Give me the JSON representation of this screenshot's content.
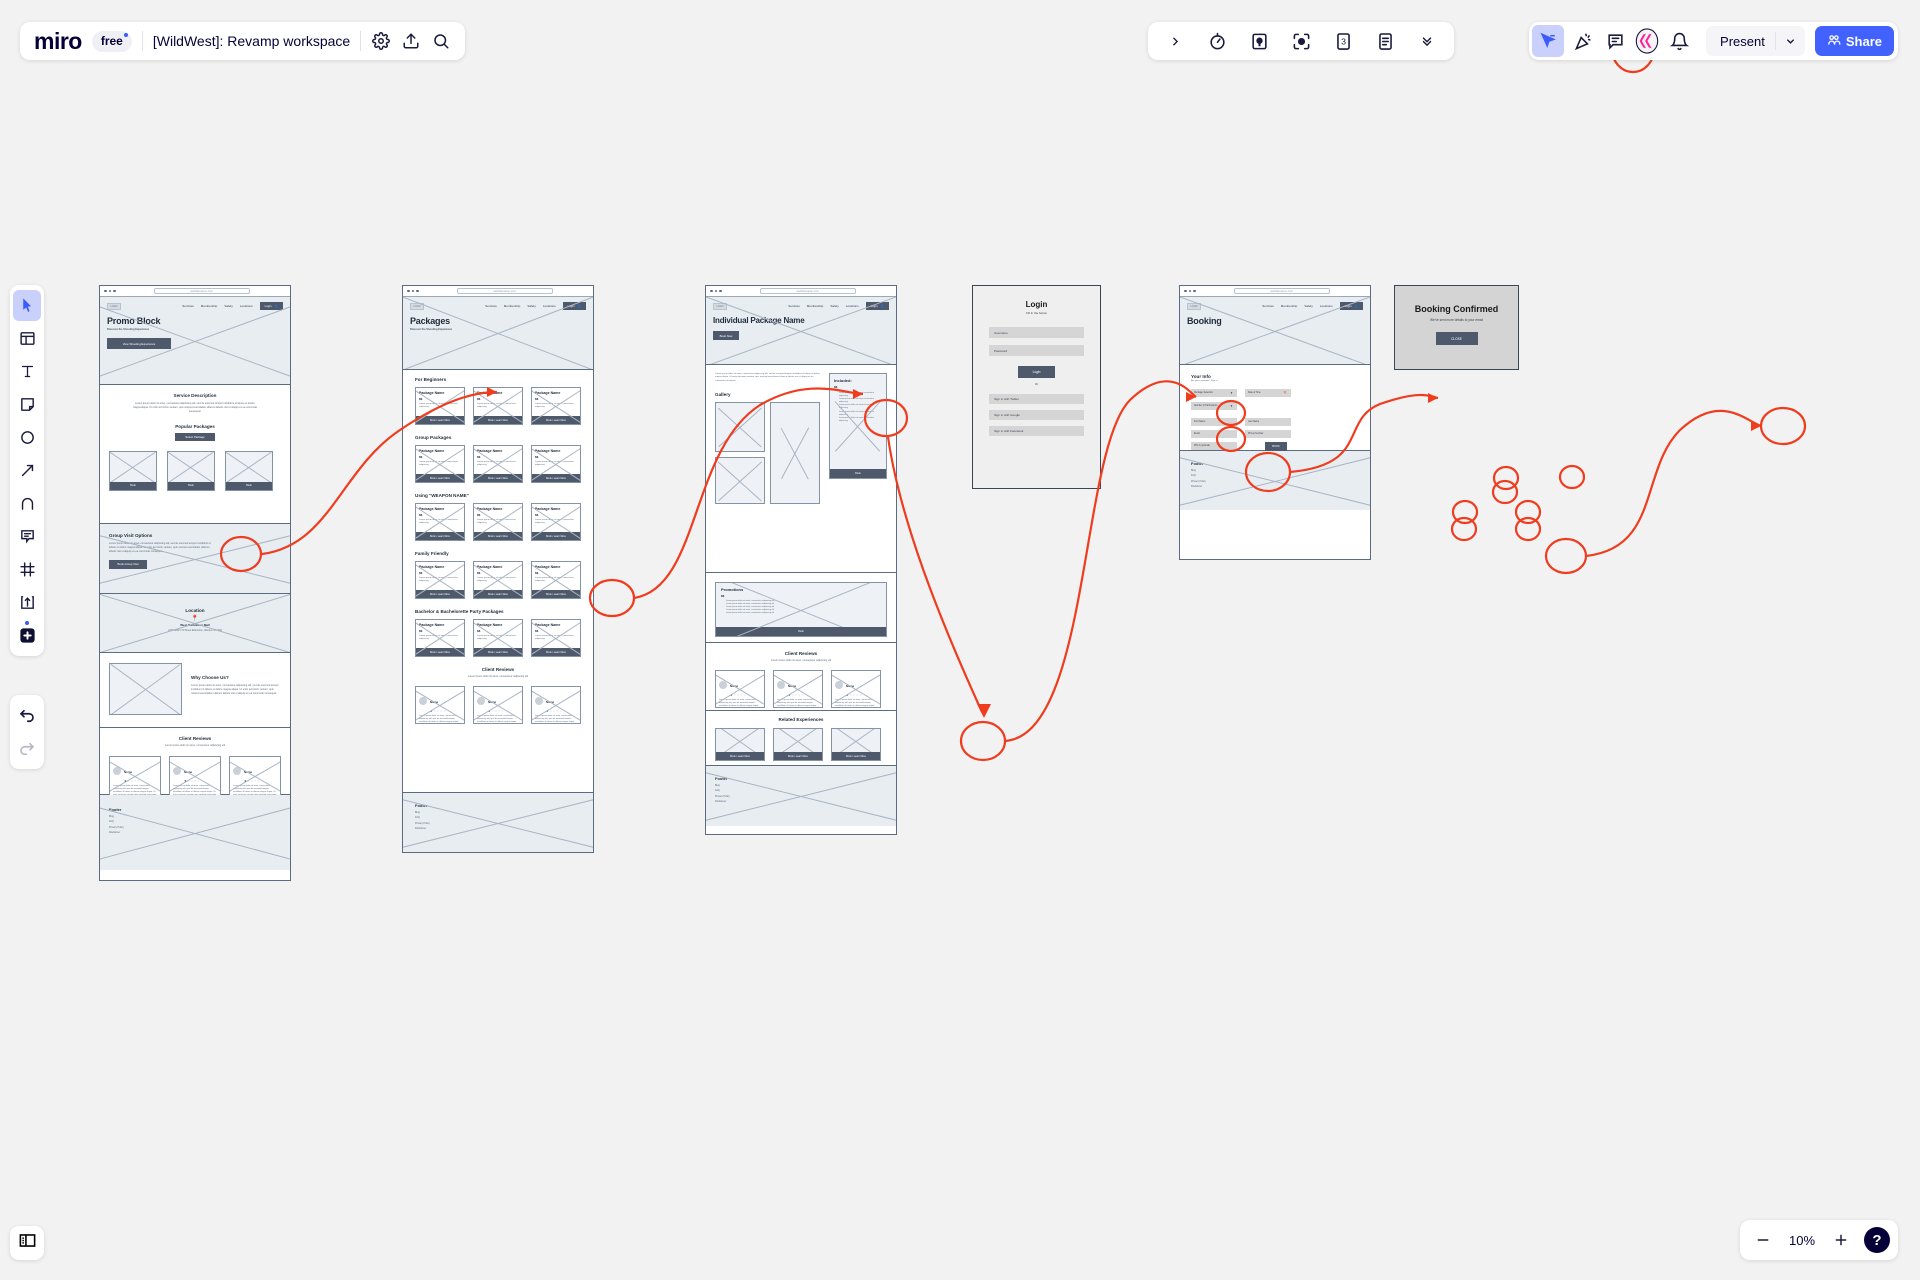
{
  "header": {
    "logo": "miro",
    "plan_badge": "free",
    "board_title": "[WildWest]: Revamp workspace",
    "icons": [
      "gear-icon",
      "upload-icon",
      "search-icon"
    ]
  },
  "toolbar_center": {
    "items": [
      "chevron-right-icon",
      "timer-icon",
      "video-icon",
      "focus-icon",
      "voting-icon",
      "notes-icon",
      "chevron-double-down-icon"
    ]
  },
  "toolbar_right": {
    "cursor_label": "cursor-share-icon",
    "reactions_label": "reactions-icon",
    "comment_label": "comment-icon",
    "miro_assist_label": "miro-ai-icon",
    "bell_label": "notifications-icon",
    "present_label": "Present",
    "share_label": "Share"
  },
  "left_toolbar": {
    "items": [
      {
        "name": "select-tool",
        "icon": "cursor-icon",
        "selected": true
      },
      {
        "name": "templates-tool",
        "icon": "templates-icon",
        "selected": false
      },
      {
        "name": "text-tool",
        "icon": "text-icon",
        "selected": false
      },
      {
        "name": "sticky-note-tool",
        "icon": "sticky-note-icon",
        "selected": false
      },
      {
        "name": "shapes-tool",
        "icon": "circle-icon",
        "selected": false
      },
      {
        "name": "connector-tool",
        "icon": "arrow-icon",
        "selected": false
      },
      {
        "name": "pen-tool",
        "icon": "pen-icon",
        "selected": false
      },
      {
        "name": "comment-tool",
        "icon": "comment-icon",
        "selected": false
      },
      {
        "name": "frame-tool",
        "icon": "frame-icon",
        "selected": false
      },
      {
        "name": "upload-tool",
        "icon": "upload-icon",
        "selected": false
      },
      {
        "name": "more-apps-tool",
        "icon": "plus-icon",
        "selected": false
      }
    ],
    "undo": "undo-icon",
    "redo": "redo-icon"
  },
  "zoom_control": {
    "minus": "−",
    "level": "10%",
    "plus": "+",
    "help": "?"
  },
  "panel_toggle": "panel-toggle-icon",
  "shared": {
    "url": "websitename.com",
    "logo": "LOGO",
    "nav": [
      "Services",
      "Membership",
      "Safety",
      "Locations"
    ],
    "login_button": "Login",
    "footer_title": "Footer",
    "footer_links": [
      "Blog",
      "FAQ",
      "Privacy Policy",
      "Disclaimer"
    ],
    "lorem_short": "Lorem ipsum dolor sit amet, consectetur adipiscing elit",
    "lorem_med": "Lorem ipsum dolor sit amet, consectetur adipiscing elit, sed do eiusmod tempor incididunt ut labore et dolore magna aliqua. Ut enim ad minim veniam, quis nostrud exercitation ullamco laboris nisi ut aliquip ex ea commodo consequat.",
    "reviews_title": "Client Reviews",
    "review_name": "Name",
    "review_text": "Lorem ipsum dolor sit amet, consectetur adipiscing elit, quis do eiusmod tempor incididunt ut labore et dolore magna aliqua. Ut enim ad minim veniam quis nostqud exercitatio",
    "package_name": "Package Name",
    "package_price": "$$",
    "package_desc": "Lorem ipsum dolor sit amet, consectetur adipiscing",
    "package_cta": "Book • Learn More"
  },
  "screen1": {
    "hero_title": "Promo Block",
    "hero_sub": "Discover the Shooting Experience",
    "hero_cta": "View Shooting Experience",
    "service_title": "Service Description",
    "popular_title": "Popular Packages",
    "select_package_btn": "Select Package",
    "book_btn": "Book",
    "group_title": "Group Visit Options",
    "group_cta": "Book Group Visit",
    "location_title": "Location",
    "location_name": "West Edmonton Mall",
    "location_addr": "2200-8882 170 Street Edmonton, Alberta T5T 4M2",
    "why_title": "Why Choose Us?"
  },
  "screen2": {
    "hero_title": "Packages",
    "hero_sub": "Discover the Shooting Experience",
    "sections": [
      "For Beginners",
      "Group Packages",
      "Using \"WEAPON NAME\"",
      "Family Friendly",
      "Bachelor & Bachelorette Party Packages"
    ]
  },
  "screen3": {
    "hero_title": "Individual Package Name",
    "hero_cta": "Book Now",
    "included_title": "Included:",
    "included_price": "$$",
    "included_bullets": [
      "Lorem ipsum dolor sit amet consectetur adipiscing",
      "Lorem ipsum dolor sit amet consectetur adipiscing",
      "Lorem ipsum dolor sit amet consectetur adipiscing",
      "Lorem ipsum dolor sit amet consectetur adipiscing",
      "Lorem ipsum dolor sit amet consectetur adipiscing"
    ],
    "included_cta": "Book",
    "gallery_title": "Gallery",
    "promotions_title": "Promotions",
    "promotions_price": "$$",
    "promotions_cta": "Book",
    "related_title": "Related Experiences"
  },
  "login_modal": {
    "title": "Login",
    "subtitle": "Fill in the below",
    "username_placeholder": "Username",
    "password_placeholder": "Password",
    "login_button": "Login",
    "divider": "Or",
    "social": [
      "Sign in with Twitter",
      "Sign in with Google",
      "Sign in with Facebook"
    ]
  },
  "screen5": {
    "hero_title": "Booking",
    "your_info_title": "Your Info",
    "member_prompt": "Are you a member? Sign in",
    "fields": {
      "package_selection": "Package Selection",
      "date_time": "Date & Time",
      "participants": "Number of Participants",
      "first_name": "First Name",
      "last_name": "Last Name",
      "email": "Email",
      "phone": "Phone Number",
      "pin": "PIN # (optional)"
    },
    "book_button": "BOOK"
  },
  "confirm_card": {
    "title": "Booking Confirmed",
    "subtitle": "We've sent more details to your email",
    "close_button": "CLOSE"
  },
  "annotations": {
    "color": "#f03c1e",
    "flow": [
      "screen1.select-package -> screen2",
      "screen2.book-learn-more -> screen3",
      "screen3.book-now -> login",
      "login.login-button -> booking",
      "booking.book-button -> confirmation"
    ]
  }
}
